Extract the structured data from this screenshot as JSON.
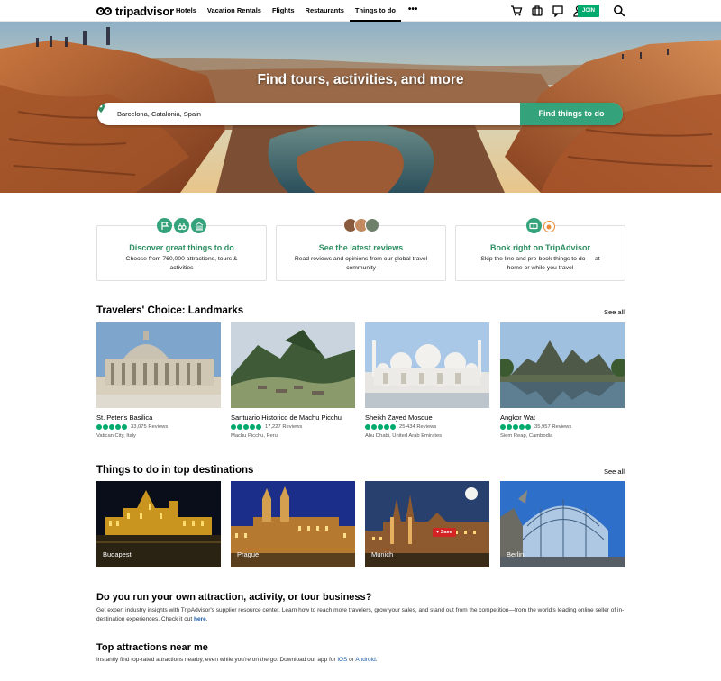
{
  "header": {
    "logo_text": "tripadvisor",
    "nav": [
      "Hotels",
      "Vacation Rentals",
      "Flights",
      "Restaurants",
      "Things to do"
    ],
    "nav_active": "Things to do",
    "more_label": "•••",
    "icons": [
      "cart-icon",
      "suitcase-icon",
      "message-icon",
      "user-icon"
    ],
    "join_label": "JOIN"
  },
  "hero": {
    "title": "Find tours, activities, and more",
    "search_value": "Barcelona, Catalonia, Spain",
    "search_button": "Find things to do"
  },
  "features": [
    {
      "title": "Discover great things to do",
      "desc": "Choose from 760,000 attractions, tours & activities"
    },
    {
      "title": "See the latest reviews",
      "desc": "Read reviews and opinions from our global travel community"
    },
    {
      "title": "Book right on TripAdvisor",
      "desc": "Skip the line and pre-book things to do — at home or while you travel"
    }
  ],
  "landmarks": {
    "title": "Travelers' Choice: Landmarks",
    "see_all": "See all",
    "items": [
      {
        "name": "St. Peter's Basilica",
        "reviews": "33,075 Reviews",
        "location": "Vatican City, Italy",
        "rating": 5
      },
      {
        "name": "Santuario Historico de Machu Picchu",
        "reviews": "17,227 Reviews",
        "location": "Machu Picchu, Peru",
        "rating": 5
      },
      {
        "name": "Sheikh Zayed Mosque",
        "reviews": "25,434 Reviews",
        "location": "Abu Dhabi, United Arab Emirates",
        "rating": 5
      },
      {
        "name": "Angkor Wat",
        "reviews": "35,957 Reviews",
        "location": "Siem Reap, Cambodia",
        "rating": 5
      }
    ]
  },
  "destinations": {
    "title": "Things to do in top destinations",
    "see_all": "See all",
    "items": [
      "Budapest",
      "Prague",
      "Munich",
      "Berlin"
    ],
    "save_label": "Save"
  },
  "business": {
    "title": "Do you run your own attraction, activity, or tour business?",
    "text": "Get expert industry insights with TripAdvisor's supplier resource center. Learn how to reach more travelers, grow your sales, and stand out from the competition—from the world's leading online seller of in-destination experiences. Check it out",
    "link": "here",
    "tail": "."
  },
  "nearby": {
    "title": "Top attractions near me",
    "text": "Instantly find top-rated attractions nearby, even while you're on the go: Download our app for",
    "ios": "iOS",
    "or": "or",
    "android": "Android",
    "tail": "."
  },
  "colors": {
    "brand_green": "#00aa6c",
    "button_green": "#34a37c",
    "title_green": "#2f8f63",
    "save_red": "#d32323",
    "link_blue": "#1a5aaa"
  }
}
